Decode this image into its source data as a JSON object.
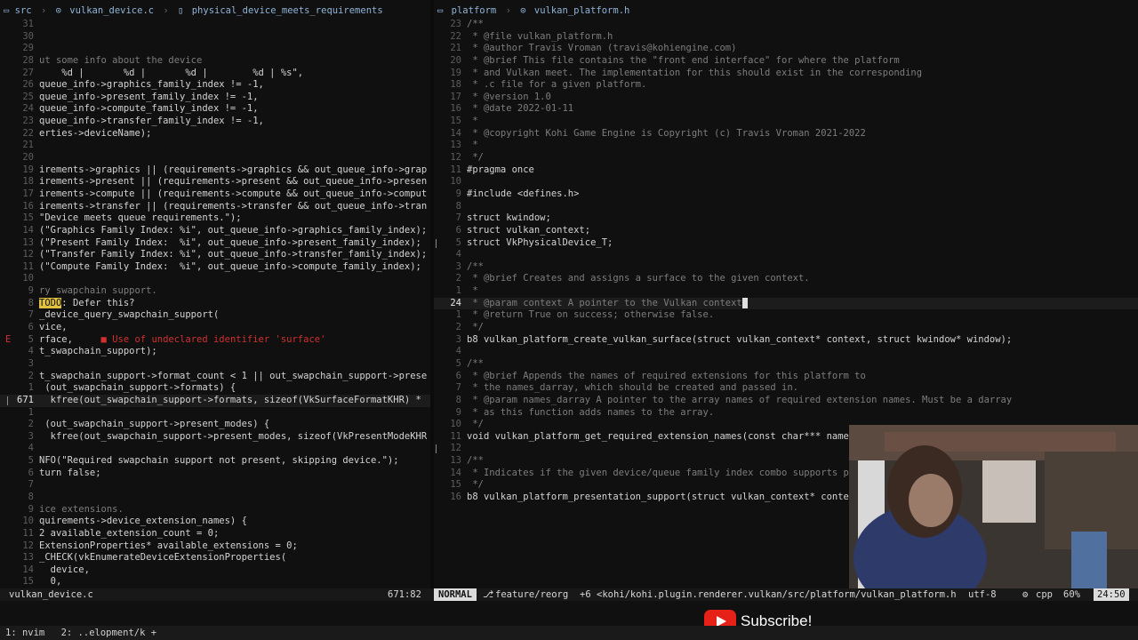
{
  "left_pane": {
    "breadcrumb": {
      "folder": "src",
      "file": "vulkan_device.c",
      "symbol": "physical_device_meets_requirements"
    },
    "lines": [
      {
        "n": "31",
        "t": ""
      },
      {
        "n": "30",
        "t": ""
      },
      {
        "n": "29",
        "t": ""
      },
      {
        "n": "28",
        "t": "ut some info about the device",
        "cls": "c-cm"
      },
      {
        "n": "27",
        "t": "    %d |       %d |       %d |        %d | %s\","
      },
      {
        "n": "26",
        "t": "queue_info->graphics_family_index != -1,"
      },
      {
        "n": "25",
        "t": "queue_info->present_family_index != -1,"
      },
      {
        "n": "24",
        "t": "queue_info->compute_family_index != -1,"
      },
      {
        "n": "23",
        "t": "queue_info->transfer_family_index != -1,"
      },
      {
        "n": "22",
        "t": "erties->deviceName);"
      },
      {
        "n": "21",
        "t": ""
      },
      {
        "n": "20",
        "t": ""
      },
      {
        "n": "19",
        "t": "irements->graphics || (requirements->graphics && out_queue_info->grap"
      },
      {
        "n": "18",
        "t": "irements->present || (requirements->present && out_queue_info->presen"
      },
      {
        "n": "17",
        "t": "irements->compute || (requirements->compute && out_queue_info->comput"
      },
      {
        "n": "16",
        "t": "irements->transfer || (requirements->transfer && out_queue_info->tran"
      },
      {
        "n": "15",
        "t": "\"Device meets queue requirements.\");"
      },
      {
        "n": "14",
        "t": "(\"Graphics Family Index: %i\", out_queue_info->graphics_family_index);"
      },
      {
        "n": "13",
        "t": "(\"Present Family Index:  %i\", out_queue_info->present_family_index);"
      },
      {
        "n": "12",
        "t": "(\"Transfer Family Index: %i\", out_queue_info->transfer_family_index);"
      },
      {
        "n": "11",
        "t": "(\"Compute Family Index:  %i\", out_queue_info->compute_family_index);"
      },
      {
        "n": "10",
        "t": ""
      },
      {
        "n": "9",
        "t": "ry swapchain support.",
        "cls": "c-cm"
      },
      {
        "n": "8",
        "todo": "TODO",
        "t": ": Defer this?"
      },
      {
        "n": "7",
        "t": "_device_query_swapchain_support("
      },
      {
        "n": "6",
        "t": "vice,"
      },
      {
        "n": "5",
        "sign": "E",
        "t": "rface,     ",
        "err": "■ Use of undeclared identifier 'surface'"
      },
      {
        "n": "4",
        "t": "t_swapchain_support);"
      },
      {
        "n": "3",
        "t": ""
      },
      {
        "n": "2",
        "t": "t_swapchain_support->format_count < 1 || out_swapchain_support->prese"
      },
      {
        "n": "1",
        "t": " (out_swapchain_support->formats) {"
      },
      {
        "n": "671",
        "t": "  kfree(out_swapchain_support->formats, sizeof(VkSurfaceFormatKHR) *",
        "cur": true
      },
      {
        "n": "1",
        "t": ""
      },
      {
        "n": "2",
        "t": " (out_swapchain_support->present_modes) {"
      },
      {
        "n": "3",
        "t": "  kfree(out_swapchain_support->present_modes, sizeof(VkPresentModeKHR"
      },
      {
        "n": "4",
        "t": ""
      },
      {
        "n": "5",
        "t": "NFO(\"Required swapchain support not present, skipping device.\");"
      },
      {
        "n": "6",
        "t": "turn false;"
      },
      {
        "n": "7",
        "t": ""
      },
      {
        "n": "8",
        "t": ""
      },
      {
        "n": "9",
        "t": "ice extensions.",
        "cls": "c-cm"
      },
      {
        "n": "10",
        "t": "quirements->device_extension_names) {"
      },
      {
        "n": "11",
        "t": "2 available_extension_count = 0;"
      },
      {
        "n": "12",
        "t": "ExtensionProperties* available_extensions = 0;"
      },
      {
        "n": "13",
        "t": "_CHECK(vkEnumerateDeviceExtensionProperties("
      },
      {
        "n": "14",
        "t": "  device,"
      },
      {
        "n": "15",
        "t": "  0,"
      }
    ]
  },
  "right_pane": {
    "breadcrumb": {
      "folder": "platform",
      "file": "vulkan_platform.h"
    },
    "lines": [
      {
        "n": "23",
        "t": "/**",
        "cls": "c-cm"
      },
      {
        "n": "22",
        "t": " * @file vulkan_platform.h",
        "cls": "c-cm"
      },
      {
        "n": "21",
        "t": " * @author Travis Vroman (travis@kohiengine.com)",
        "cls": "c-cm"
      },
      {
        "n": "20",
        "t": " * @brief This file contains the \"front end interface\" for where the platform",
        "cls": "c-cm"
      },
      {
        "n": "19",
        "t": " * and Vulkan meet. The implementation for this should exist in the corresponding",
        "cls": "c-cm"
      },
      {
        "n": "18",
        "t": " * .c file for a given platform.",
        "cls": "c-cm"
      },
      {
        "n": "17",
        "t": " * @version 1.0",
        "cls": "c-cm"
      },
      {
        "n": "16",
        "t": " * @date 2022-01-11",
        "cls": "c-cm"
      },
      {
        "n": "15",
        "t": " *",
        "cls": "c-cm"
      },
      {
        "n": "14",
        "t": " * @copyright Kohi Game Engine is Copyright (c) Travis Vroman 2021-2022",
        "cls": "c-cm"
      },
      {
        "n": "13",
        "t": " *",
        "cls": "c-cm"
      },
      {
        "n": "12",
        "t": " */",
        "cls": "c-cm"
      },
      {
        "n": "11",
        "t": "#pragma once"
      },
      {
        "n": "10",
        "t": ""
      },
      {
        "n": "9",
        "t": "#include <defines.h>"
      },
      {
        "n": "8",
        "t": ""
      },
      {
        "n": "7",
        "t": "struct kwindow;"
      },
      {
        "n": "6",
        "t": "struct vulkan_context;"
      },
      {
        "n": "5",
        "t": "struct VkPhysicalDevice_T;",
        "bar": true
      },
      {
        "n": "4",
        "t": ""
      },
      {
        "n": "3",
        "t": "/**",
        "cls": "c-cm"
      },
      {
        "n": "2",
        "t": " * @brief Creates and assigns a surface to the given context.",
        "cls": "c-cm"
      },
      {
        "n": "1",
        "t": " *",
        "cls": "c-cm"
      },
      {
        "n": "24",
        "t": " * @param context A pointer to the Vulkan context",
        "cls": "c-cm",
        "cur": true,
        "cursor": true
      },
      {
        "n": "1",
        "t": " * @return True on success; otherwise false.",
        "cls": "c-cm"
      },
      {
        "n": "2",
        "t": " */",
        "cls": "c-cm"
      },
      {
        "n": "3",
        "t": "b8 vulkan_platform_create_vulkan_surface(struct vulkan_context* context, struct kwindow* window);"
      },
      {
        "n": "4",
        "t": ""
      },
      {
        "n": "5",
        "t": "/**",
        "cls": "c-cm"
      },
      {
        "n": "6",
        "t": " * @brief Appends the names of required extensions for this platform to",
        "cls": "c-cm"
      },
      {
        "n": "7",
        "t": " * the names_darray, which should be created and passed in.",
        "cls": "c-cm"
      },
      {
        "n": "8",
        "t": " * @param names_darray A pointer to the array names of required extension names. Must be a darray",
        "cls": "c-cm"
      },
      {
        "n": "9",
        "t": " * as this function adds names to the array.",
        "cls": "c-cm"
      },
      {
        "n": "10",
        "t": " */",
        "cls": "c-cm"
      },
      {
        "n": "11",
        "t": "void vulkan_platform_get_required_extension_names(const char*** names_darray);"
      },
      {
        "n": "12",
        "t": "",
        "bar": true
      },
      {
        "n": "13",
        "t": "/**",
        "cls": "c-cm"
      },
      {
        "n": "14",
        "t": " * Indicates if the given device/queue family index combo supports presentation.",
        "cls": "c-cm"
      },
      {
        "n": "15",
        "t": " */",
        "cls": "c-cm"
      },
      {
        "n": "16",
        "t": "b8 vulkan_platform_presentation_support(struct vulkan_context* context, struct VkPhysicalDevice_T* physical_device, u32 queue_family_index);"
      }
    ]
  },
  "statusbar": {
    "left_file": "vulkan_device.c",
    "left_pos": "671:82",
    "mode": "NORMAL",
    "branch_icon": "git-branch-icon",
    "branch": "feature/reorg",
    "changes": "+6",
    "path": "<kohi/kohi.plugin.renderer.vulkan/src/platform/vulkan_platform.h",
    "encoding": "utf-8",
    "filetype": "cpp",
    "percent": "60%",
    "position": "24:50"
  },
  "tmux": {
    "window1": "1: nvim",
    "window2": "2: ..elopment/k +"
  },
  "overlay": {
    "subscribe": "Subscribe!"
  },
  "colors": {
    "background": "#101010",
    "error": "#d03030",
    "todo": "#e0c040",
    "youtube_red": "#e62117"
  }
}
